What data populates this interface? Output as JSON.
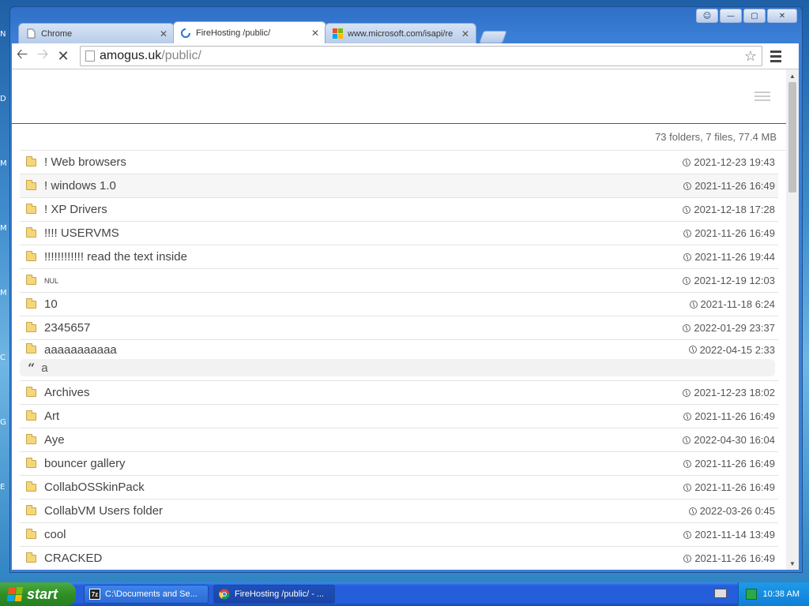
{
  "browser": {
    "tabs": [
      {
        "title": "Chrome",
        "icon": "page-icon",
        "active": false
      },
      {
        "title": "FireHosting /public/",
        "icon": "loading-spinner-icon",
        "active": true
      },
      {
        "title": "www.microsoft.com/isapi/re",
        "icon": "microsoft-logo-icon",
        "active": false
      }
    ],
    "url_host": "amogus.uk",
    "url_path": "/public/"
  },
  "listing": {
    "summary": "73 folders, 7 files, 77.4 MB",
    "rows": [
      {
        "name": "! Web browsers",
        "date": "2021-12-23 19:43"
      },
      {
        "name": "! windows 1.0",
        "date": "2021-11-26 16:49"
      },
      {
        "name": "! XP Drivers",
        "date": "2021-12-18 17:28"
      },
      {
        "name": "!!!! USERVMS",
        "date": "2021-11-26 16:49"
      },
      {
        "name": "!!!!!!!!!!!! read the text inside",
        "date": "2021-11-26 19:44"
      },
      {
        "name": "NUL",
        "date": "2021-12-19 12:03"
      },
      {
        "name": "10",
        "date": "2021-11-18 6:24"
      },
      {
        "name": "2345657",
        "date": "2022-01-29 23:37"
      },
      {
        "name": "aaaaaaaaaaa",
        "date": "2022-04-15 2:33",
        "quote": "a"
      },
      {
        "name": "Archives",
        "date": "2021-12-23 18:02"
      },
      {
        "name": "Art",
        "date": "2021-11-26 16:49"
      },
      {
        "name": "Aye",
        "date": "2022-04-30 16:04"
      },
      {
        "name": "bouncer gallery",
        "date": "2021-11-26 16:49"
      },
      {
        "name": "CollabOSSkinPack",
        "date": "2021-11-26 16:49"
      },
      {
        "name": "CollabVM Users folder",
        "date": "2022-03-26 0:45"
      },
      {
        "name": "cool",
        "date": "2021-11-14 13:49"
      },
      {
        "name": "CRACKED",
        "date": "2021-11-26 16:49"
      }
    ]
  },
  "taskbar": {
    "start_label": "start",
    "items": [
      {
        "label": "C:\\Documents and Se...",
        "icon": "7zip-icon"
      },
      {
        "label": "FireHosting /public/ - ...",
        "icon": "chrome-icon"
      }
    ],
    "clock": "10:38 AM"
  },
  "colors": {
    "folder": "#f5d679",
    "taskbar": "#245edb",
    "start": "#2f8f26"
  }
}
